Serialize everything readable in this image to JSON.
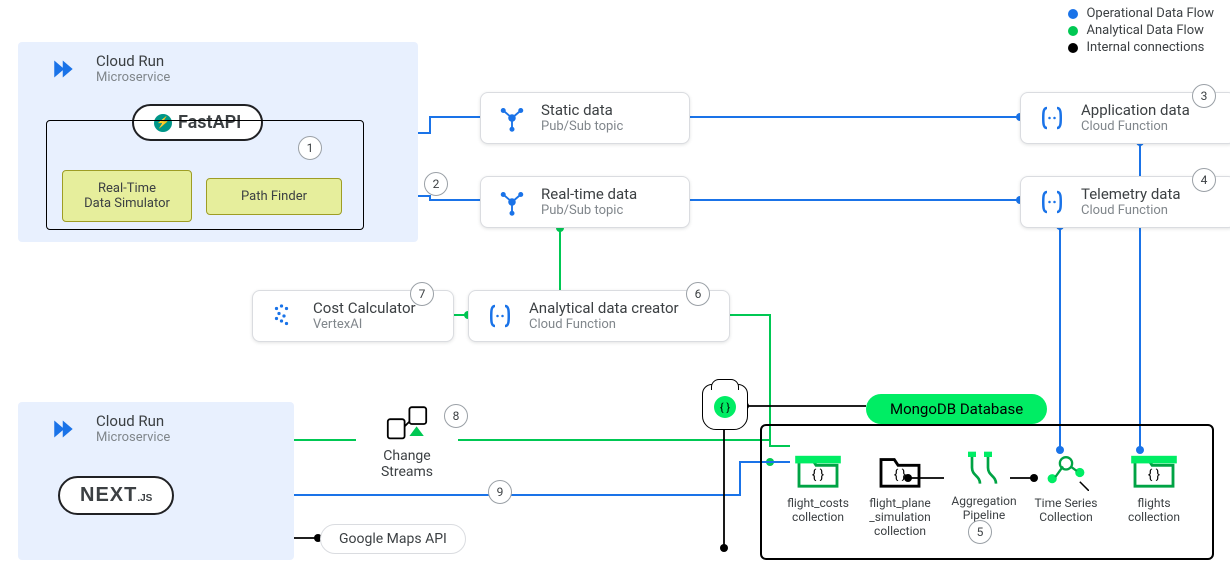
{
  "legend": [
    {
      "color": "#1a73e8",
      "label": "Operational Data Flow"
    },
    {
      "color": "#00c853",
      "label": "Analytical Data Flow"
    },
    {
      "color": "#000000",
      "label": "Internal connections"
    }
  ],
  "cloudrun1": {
    "title": "Cloud Run",
    "sub": "Microservice"
  },
  "fastapi": {
    "label": "FastAPI"
  },
  "rts": {
    "label": "Real-Time\nData Simulator"
  },
  "pathfinder": {
    "label": "Path Finder"
  },
  "static": {
    "title": "Static data",
    "sub": "Pub/Sub topic"
  },
  "realtime": {
    "title": "Real-time data",
    "sub": "Pub/Sub topic"
  },
  "appdata": {
    "title": "Application data",
    "sub": "Cloud Function"
  },
  "telemetry": {
    "title": "Telemetry data",
    "sub": "Cloud Function"
  },
  "costcalc": {
    "title": "Cost Calculator",
    "sub": "VertexAI"
  },
  "anacreator": {
    "title": "Analytical data creator",
    "sub": "Cloud Function"
  },
  "cloudrun2": {
    "title": "Cloud Run",
    "sub": "Microservice"
  },
  "nextjs": {
    "label": "NEXT",
    "suffix": ".JS"
  },
  "gmaps": {
    "label": "Google Maps API"
  },
  "changestreams": {
    "label": "Change Streams"
  },
  "mongodb": {
    "label": "MongoDB Database"
  },
  "db_items": {
    "flightcosts": "flight_costs collection",
    "flightplane": "flight_plane _simulation collection",
    "aggpipe": "Aggregation Pipeline",
    "timeseries": "Time Series Collection",
    "flights": "flights collection"
  },
  "nums": {
    "1": "1",
    "2": "2",
    "3": "3",
    "4": "4",
    "5": "5",
    "6": "6",
    "7": "7",
    "8": "8",
    "9": "9"
  }
}
